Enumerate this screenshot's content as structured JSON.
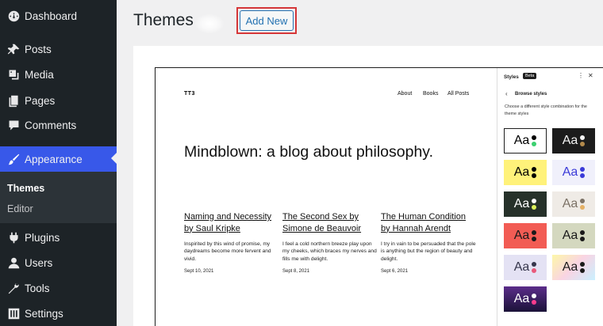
{
  "sidebar": {
    "items": [
      {
        "label": "Dashboard",
        "icon": "dashboard-icon"
      },
      {
        "label": "Posts",
        "icon": "pin-icon"
      },
      {
        "label": "Media",
        "icon": "media-icon"
      },
      {
        "label": "Pages",
        "icon": "pages-icon"
      },
      {
        "label": "Comments",
        "icon": "comment-icon"
      },
      {
        "label": "Appearance",
        "icon": "brush-icon"
      },
      {
        "label": "Plugins",
        "icon": "plug-icon"
      },
      {
        "label": "Users",
        "icon": "users-icon"
      },
      {
        "label": "Tools",
        "icon": "wrench-icon"
      },
      {
        "label": "Settings",
        "icon": "settings-icon"
      }
    ],
    "submenu": [
      {
        "label": "Themes"
      },
      {
        "label": "Editor"
      }
    ],
    "accent": "#3858e9"
  },
  "header": {
    "title": "Themes",
    "add_new_label": "Add New",
    "highlight_color": "#d63638"
  },
  "preview": {
    "site_title": "TT3",
    "nav": [
      "About",
      "Books",
      "All Posts"
    ],
    "hero": "Mindblown: a blog about philosophy.",
    "posts": [
      {
        "title": "Naming and Necessity by Saul Kripke",
        "excerpt": "Inspirited by this wind of promise, my daydreams become more fervent and vivid.",
        "date": "Sept 10, 2021"
      },
      {
        "title": "The Second Sex by Simone de Beauvoir",
        "excerpt": "I feel a cold northern breeze play upon my cheeks, which braces my nerves and fills me with delight.",
        "date": "Sept 8, 2021"
      },
      {
        "title": "The Human Condition by Hannah Arendt",
        "excerpt": "I try in vain to be persuaded that the pole is anything but the region of beauty and delight.",
        "date": "Sept 6, 2021"
      }
    ]
  },
  "styles_panel": {
    "title": "Styles",
    "badge": "Beta",
    "more": "⋮",
    "close": "✕",
    "back": "‹",
    "browse": "Browse styles",
    "description": "Choose a different style combination for the theme styles",
    "swatches": [
      {
        "bg": "#ffffff",
        "fg": "#000000",
        "dot1": "#000000",
        "dot2": "#3cd070",
        "selected": true
      },
      {
        "bg": "#1c1c1c",
        "fg": "#f4f4f4",
        "dot1": "#f4f4f4",
        "dot2": "#b38a4b"
      },
      {
        "bg": "#fff27a",
        "fg": "#000000",
        "dot1": "#000000",
        "dot2": "#000000"
      },
      {
        "bg": "#f0f0fb",
        "fg": "#3b3bd8",
        "dot1": "#3b3bd8",
        "dot2": "#3b3bd8"
      },
      {
        "bg": "#26312a",
        "fg": "#ffffff",
        "dot1": "#ffffff",
        "dot2": "#dcf05b"
      },
      {
        "bg": "#efebe6",
        "fg": "#7c7266",
        "dot1": "#7c7266",
        "dot2": "#e4b065"
      },
      {
        "bg": "#f25c54",
        "fg": "#1a1a1a",
        "dot1": "#1a1a1a",
        "dot2": "#1a1a1a"
      },
      {
        "bg": "#d4d8bf",
        "fg": "#1a1a1a",
        "dot1": "#1a1a1a",
        "dot2": "#1a1a1a"
      },
      {
        "bg": "#e4e2f4",
        "fg": "#36364c",
        "dot1": "#36364c",
        "dot2": "#e95a7b"
      },
      {
        "bg": "#f7f3c0",
        "fg": "#1a1a1a",
        "dot1": "#1a1a1a",
        "dot2": "#1a1a1a",
        "gradient": true
      },
      {
        "bg": "#2a1f4a",
        "fg": "#ffffff",
        "dot1": "#ffffff",
        "dot2": "#ff3c8d",
        "purple": true
      }
    ],
    "swatch_text": "Aa"
  }
}
